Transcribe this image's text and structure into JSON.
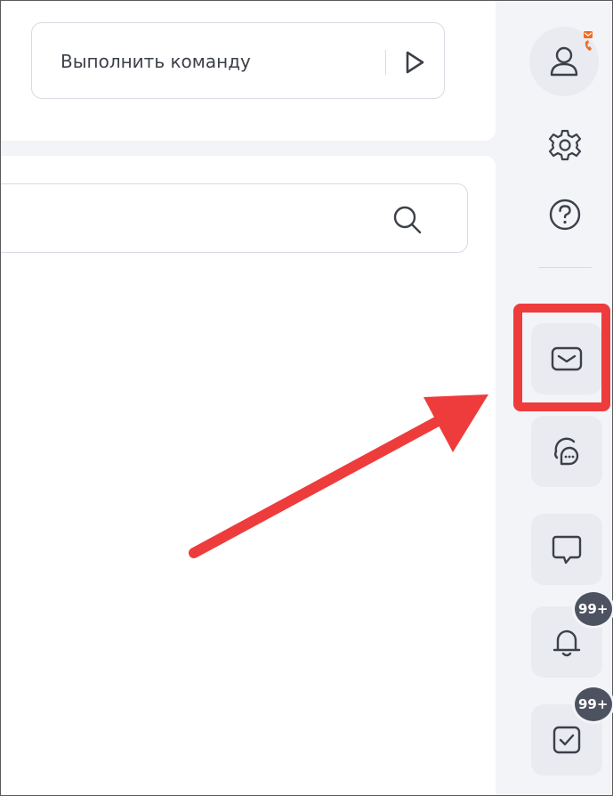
{
  "command": {
    "placeholder": "Выполнить команду"
  },
  "search": {
    "value": ""
  },
  "sidebar": {
    "items": [
      {
        "icon": "user-icon"
      },
      {
        "icon": "gear-icon"
      },
      {
        "icon": "help-icon"
      },
      {
        "icon": "mail-icon"
      },
      {
        "icon": "chats-icon"
      },
      {
        "icon": "chat-icon"
      },
      {
        "icon": "bell-icon",
        "badge": "99+"
      },
      {
        "icon": "task-checkbox-icon",
        "badge": "99+"
      }
    ]
  },
  "colors": {
    "accent": "#ee3c3c",
    "badge_orange": "#f26b21",
    "icon": "#3c4049",
    "tile": "#e9ebf1",
    "badge_bg": "#4d5260"
  }
}
